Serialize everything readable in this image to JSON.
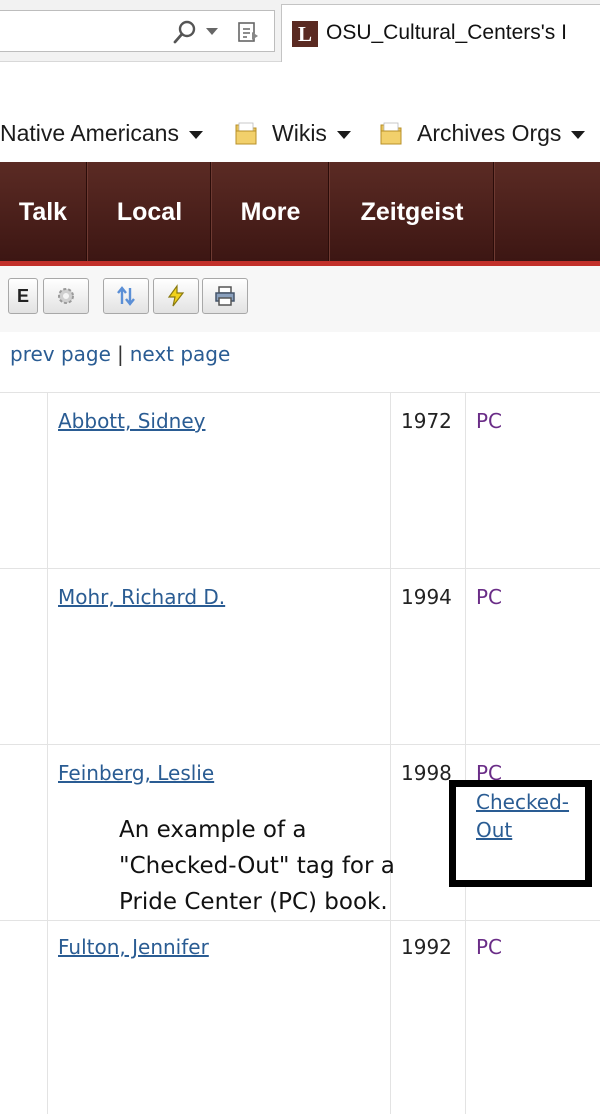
{
  "browser": {
    "tab_favicon_letter": "L",
    "tab_title": "OSU_Cultural_Centers's I"
  },
  "favorites": [
    {
      "label": "Native Americans",
      "has_folder": false
    },
    {
      "label": "Wikis",
      "has_folder": true
    },
    {
      "label": "Archives Orgs",
      "has_folder": true
    }
  ],
  "nav": {
    "items": [
      "Talk",
      "Local",
      "More",
      "Zeitgeist"
    ]
  },
  "toolbar": {
    "edit_label": "E"
  },
  "pager": {
    "prev_label": "prev page",
    "separator": "|",
    "next_label": "next page"
  },
  "table": {
    "rows": [
      {
        "author": "Abbott, Sidney",
        "year": "1972",
        "collection": "PC"
      },
      {
        "author": "Mohr, Richard D.",
        "year": "1994",
        "collection": "PC"
      },
      {
        "author": "Feinberg, Leslie",
        "year": "1998",
        "collection": "PC",
        "tag": "Checked-Out"
      },
      {
        "author": "Fulton, Jennifer",
        "year": "1992",
        "collection": "PC"
      }
    ]
  },
  "annotation": {
    "line1": "An example of a",
    "line2": "\"Checked-Out\" tag for a",
    "line3": "Pride Center (PC) book."
  },
  "colors": {
    "nav_bg": "#4a1f1a",
    "nav_accent": "#c2302a",
    "link": "#2a5c93",
    "collection": "#6a2d87"
  }
}
